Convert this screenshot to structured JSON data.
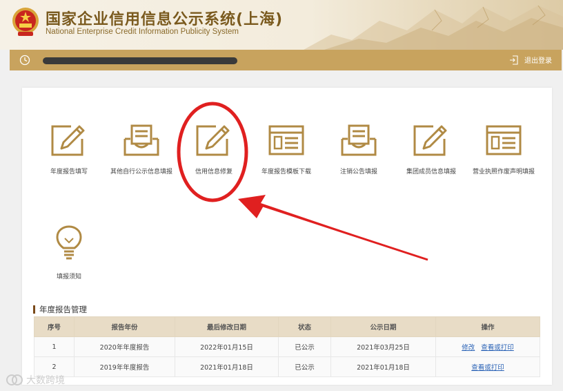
{
  "header": {
    "title_cn": "国家企业信用信息公示系统(上海)",
    "title_en": "National Enterprise Credit Information Publicity System"
  },
  "toolbar": {
    "logout_label": "退出登录"
  },
  "tiles": [
    {
      "label": "年度报告填写",
      "icon": "pencil-square-icon"
    },
    {
      "label": "其他自行公示信息填报",
      "icon": "document-tray-icon"
    },
    {
      "label": "信用信息修复",
      "icon": "pencil-square-icon"
    },
    {
      "label": "年度报告模板下载",
      "icon": "form-list-icon"
    },
    {
      "label": "注销公告填报",
      "icon": "document-tray-icon"
    },
    {
      "label": "集团成员信息填报",
      "icon": "pencil-square-icon"
    },
    {
      "label": "营业执照作废声明填报",
      "icon": "form-list-icon"
    },
    {
      "label": "填报须知",
      "icon": "lightbulb-icon"
    }
  ],
  "section": {
    "title": "年度报告管理"
  },
  "table": {
    "headers": [
      "序号",
      "报告年份",
      "最后修改日期",
      "状态",
      "公示日期",
      "操作"
    ],
    "rows": [
      {
        "no": "1",
        "year": "2020年年度报告",
        "modified": "2022年01月15日",
        "status": "已公示",
        "published": "2021年03月25日",
        "actions": [
          "修改",
          "查看或打印"
        ]
      },
      {
        "no": "2",
        "year": "2019年年度报告",
        "modified": "2021年01月18日",
        "status": "已公示",
        "published": "2021年01月18日",
        "actions": [
          "查看或打印"
        ]
      }
    ]
  },
  "watermark": "大数跨境",
  "colors": {
    "gold": "#b08a44",
    "bar": "#c8a35e",
    "annotation_red": "#e02020"
  }
}
